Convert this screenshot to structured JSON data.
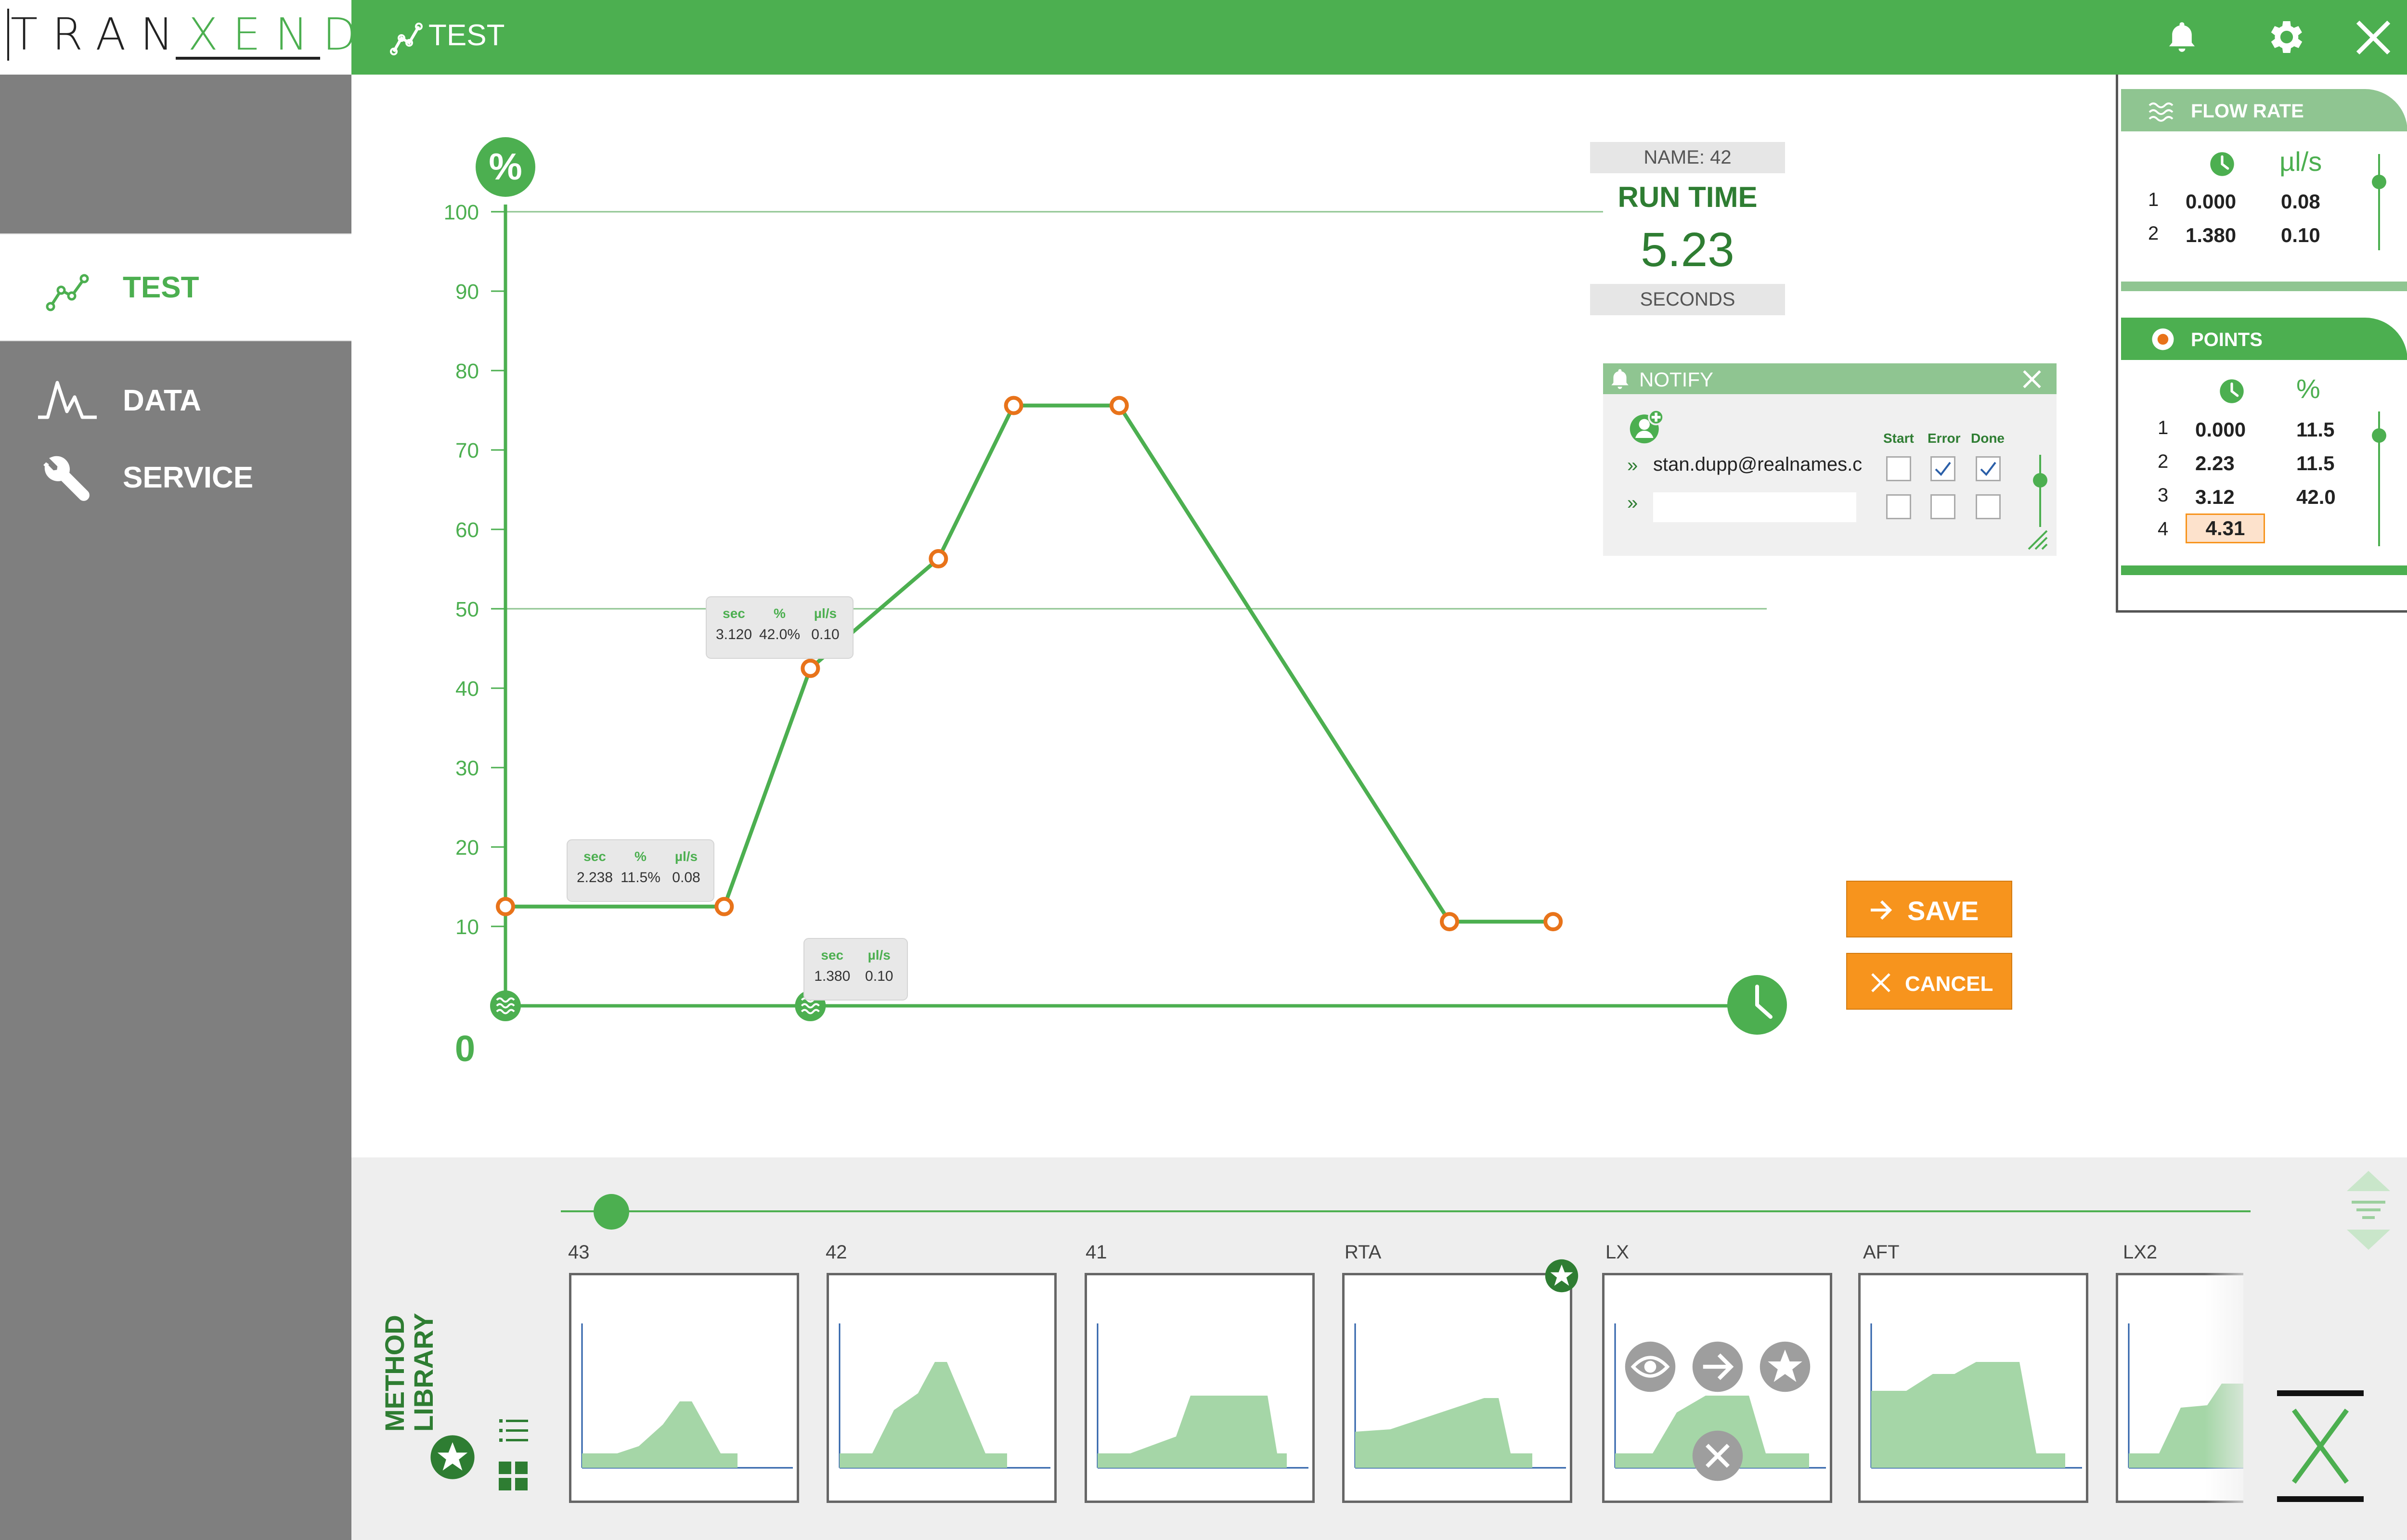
{
  "app": {
    "logo_left": "TRAN",
    "logo_right": "XEND",
    "header_title": "TEST"
  },
  "sidebar": {
    "items": [
      {
        "label": "TEST",
        "icon": "chart-line-icon",
        "active": true
      },
      {
        "label": "DATA",
        "icon": "waveform-icon",
        "active": false
      },
      {
        "label": "SERVICE",
        "icon": "wrench-icon",
        "active": false
      }
    ]
  },
  "run": {
    "name": "NAME: 42",
    "title": "RUN TIME",
    "value": "5.23",
    "unit": "SECONDS"
  },
  "chart_data": {
    "type": "line",
    "y_icon_label": "%",
    "origin_label": "0",
    "yticks": [
      10,
      20,
      30,
      40,
      50,
      60,
      70,
      80,
      90,
      100
    ],
    "ylim": [
      0,
      100
    ],
    "points": [
      {
        "x": 0,
        "y": 12.5
      },
      {
        "x": 2.238,
        "y": 12.5
      },
      {
        "x": 3.12,
        "y": 42.5
      },
      {
        "x": 4.43,
        "y": 56.3
      },
      {
        "x": 5.2,
        "y": 75.6
      },
      {
        "x": 6.28,
        "y": 75.6
      },
      {
        "x": 9.66,
        "y": 10.6
      },
      {
        "x": 10.72,
        "y": 10.6
      }
    ],
    "flow_markers": [
      {
        "x": 0
      },
      {
        "x": 3.12
      }
    ],
    "tooltips": [
      {
        "headers": [
          "sec",
          "%",
          "µl/s"
        ],
        "values": [
          "3.120",
          "42.0%",
          "0.10"
        ]
      },
      {
        "headers": [
          "sec",
          "%",
          "µl/s"
        ],
        "values": [
          "2.238",
          "11.5%",
          "0.08"
        ]
      },
      {
        "headers": [
          "sec",
          "µl/s"
        ],
        "values": [
          "1.380",
          "0.10"
        ]
      }
    ]
  },
  "notify": {
    "title": "NOTIFY",
    "col_start": "Start",
    "col_error": "Error",
    "col_done": "Done",
    "email": "stan.dupp@realnames.c",
    "new_email_value": "",
    "arrow": "»",
    "rows": [
      {
        "start": false,
        "error": true,
        "done": true
      },
      {
        "start": false,
        "error": false,
        "done": false
      }
    ]
  },
  "flow_rate": {
    "title": "FLOW RATE",
    "col2": "µl/s",
    "rows": [
      {
        "idx": "1",
        "time": "0.000",
        "rate": "0.08"
      },
      {
        "idx": "2",
        "time": "1.380",
        "rate": "0.10"
      }
    ]
  },
  "points_panel": {
    "title": "POINTS",
    "col2": "%",
    "rows": [
      {
        "idx": "1",
        "time": "0.000",
        "pct": "11.5"
      },
      {
        "idx": "2",
        "time": "2.23",
        "pct": "11.5"
      },
      {
        "idx": "3",
        "time": "3.12",
        "pct": "42.0"
      },
      {
        "idx": "4",
        "time": "4.31",
        "pct": ""
      }
    ]
  },
  "actions": {
    "save": "SAVE",
    "cancel": "CANCEL"
  },
  "library": {
    "title_line1": "METHOD",
    "title_line2": "LIBRARY",
    "items": [
      "43",
      "42",
      "41",
      "RTA",
      "LX",
      "AFT",
      "LX2"
    ],
    "slider_value": 0.03
  },
  "colors": {
    "green": "#4caf50",
    "light_green": "#8fc591",
    "orange": "#f7941d",
    "point_orange": "#e8731a",
    "sidebar_gray": "#7f7f7f"
  }
}
